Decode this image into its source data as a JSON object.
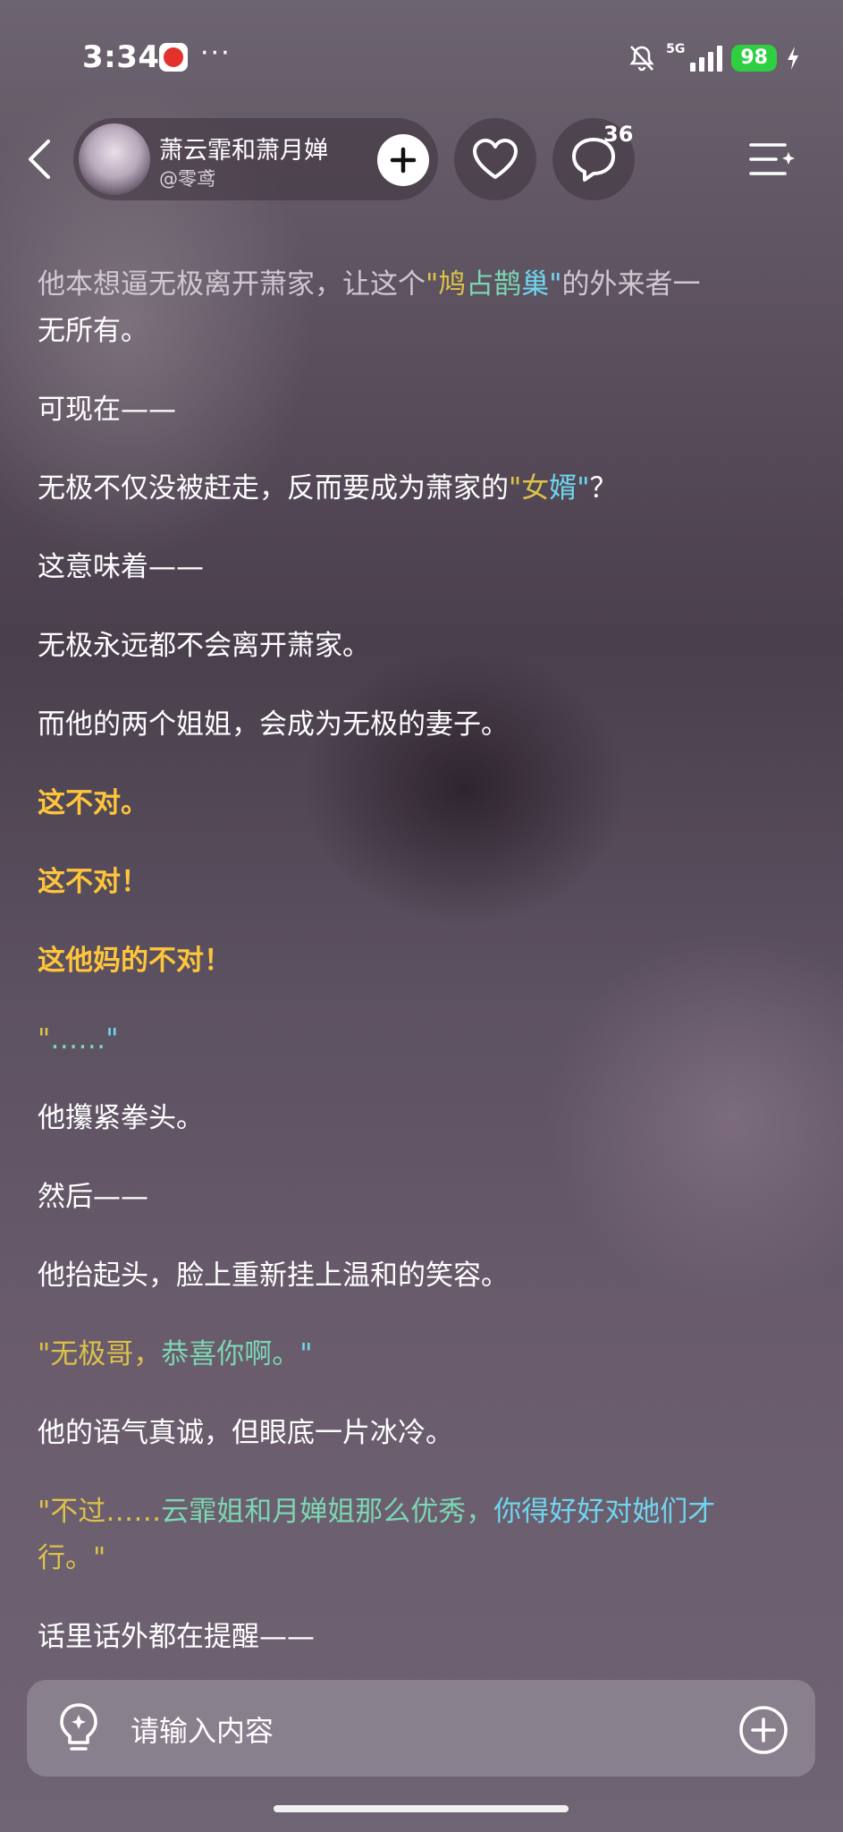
{
  "status_bar": {
    "time": "3:34",
    "more": "···",
    "network": "5G",
    "battery": "98"
  },
  "header": {
    "author_name": "萧云霏和萧月婵",
    "author_handle": "@零鸢",
    "comment_count": "36"
  },
  "content": {
    "p1": "他本想逼无极离开萧家，让这个",
    "p1_q_open": "\"鸠",
    "p1_q_mid": "占鹊",
    "p1_q_end": "巢\"",
    "p1_rest": "的外来者一",
    "p1_line2": "无所有。",
    "p2": "可现在——",
    "p3_a": "无极不仅没被赶走，反而要成为萧家的",
    "p3_q1": "\"女",
    "p3_q2": "婿\"",
    "p3_b": "？",
    "p4": "这意味着——",
    "p5": "无极永远都不会离开萧家。",
    "p6": "而他的两个姐姐，会成为无极的妻子。",
    "p7": "这不对。",
    "p8": "这不对！",
    "p9": "这他妈的不对！",
    "p10_a": "\"",
    "p10_b": "……",
    "p10_c": "\"",
    "p11": "他攥紧拳头。",
    "p12": "然后——",
    "p13": "他抬起头，脸上重新挂上温和的笑容。",
    "p14_a": "\"无极哥，",
    "p14_b": "恭喜你啊。",
    "p14_c": "\"",
    "p15": "他的语气真诚，但眼底一片冰冷。",
    "p16_a": "\"不过……",
    "p16_b": "云霏姐和月婵姐那么优秀，",
    "p16_c": "你得好好对她们才",
    "p16_line2": "行。\"",
    "p17": "话里话外都在提醒——"
  },
  "input": {
    "placeholder": "请输入内容"
  },
  "colors": {
    "highlight_yellow": "#ffc53a",
    "quote_gold": "#dcc24a",
    "quote_green": "#7bd7b2",
    "quote_cyan": "#6fd5ee",
    "battery_green": "#2fcf42"
  }
}
